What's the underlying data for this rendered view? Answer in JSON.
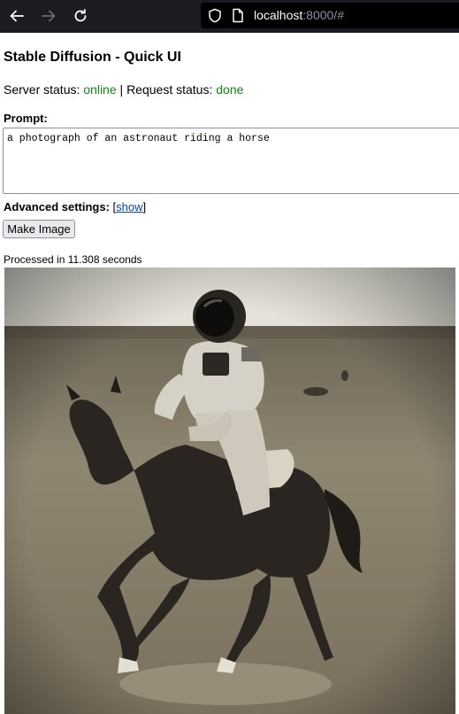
{
  "browser": {
    "url_host": "localhost",
    "url_rest": ":8000/#"
  },
  "page": {
    "title": "Stable Diffusion - Quick UI",
    "server_status_label": "Server status: ",
    "server_status_value": "online",
    "separator": " | ",
    "request_status_label": "Request status: ",
    "request_status_value": "done",
    "prompt_label": "Prompt:",
    "prompt_value": "a photograph of an astronaut riding a horse",
    "advanced_label": "Advanced settings:",
    "advanced_toggle": "show",
    "make_button": "Make Image",
    "processed_text": "Processed in 11.308 seconds"
  },
  "colors": {
    "status_ok": "#118811",
    "link": "#0645ad",
    "toolbar_bg": "#1c1b22"
  },
  "icons": [
    "back-icon",
    "forward-icon",
    "reload-icon",
    "shield-icon",
    "page-icon"
  ]
}
